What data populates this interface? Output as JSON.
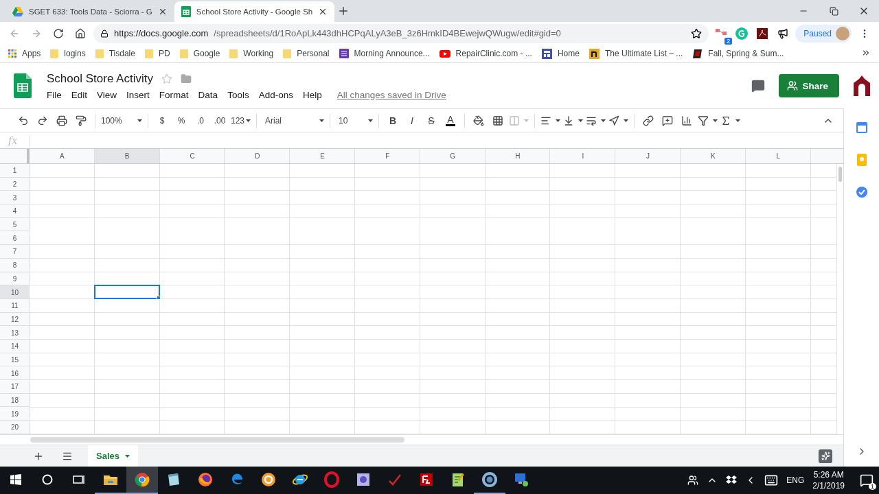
{
  "browser": {
    "tabs": [
      {
        "title": "SGET 633: Tools Data - Sciorra - G",
        "kind": "drive",
        "selected": false
      },
      {
        "title": "School Store Activity - Google Sh",
        "kind": "sheets",
        "selected": true
      }
    ],
    "url_host": "https://docs.google.com",
    "url_path": "/spreadsheets/d/1RoApLk443dhHCPqALyA3eB_3z6HmkID4BEwejwQWugw/edit#gid=0",
    "extension_badge": "2",
    "profile": "Paused",
    "bookmarks": [
      {
        "label": "Apps",
        "kind": "apps"
      },
      {
        "label": "logins",
        "kind": "folder"
      },
      {
        "label": "Tisdale",
        "kind": "folder"
      },
      {
        "label": "PD",
        "kind": "folder"
      },
      {
        "label": "Google",
        "kind": "folder"
      },
      {
        "label": "Working",
        "kind": "folder"
      },
      {
        "label": "Personal",
        "kind": "folder"
      },
      {
        "label": "Morning Announce...",
        "kind": "form"
      },
      {
        "label": "RepairClinic.com - ...",
        "kind": "video"
      },
      {
        "label": "Home",
        "kind": "site"
      },
      {
        "label": "The Ultimate List – ...",
        "kind": "n"
      },
      {
        "label": "Fall, Spring & Sum...",
        "kind": "bc"
      }
    ]
  },
  "doc": {
    "title": "School Store Activity",
    "menu": [
      "File",
      "Edit",
      "View",
      "Insert",
      "Format",
      "Data",
      "Tools",
      "Add-ons",
      "Help"
    ],
    "save_status": "All changes saved in Drive",
    "share": "Share"
  },
  "toolbar": {
    "zoom": "100%",
    "currency": "$",
    "percent": "%",
    "decrease_decimal": ".0",
    "increase_decimal": ".00",
    "more_formats": "123",
    "font": "Arial",
    "font_size": "10",
    "bold": "B",
    "italic": "I",
    "strikethrough": "S",
    "text_color": "A"
  },
  "formula_bar": {
    "label": "fx"
  },
  "grid": {
    "columns": [
      {
        "label": "A",
        "selected": false
      },
      {
        "label": "B",
        "selected": true
      },
      {
        "label": "C",
        "selected": false
      },
      {
        "label": "D",
        "selected": false
      },
      {
        "label": "E",
        "selected": false
      },
      {
        "label": "F",
        "selected": false
      },
      {
        "label": "G",
        "selected": false
      },
      {
        "label": "H",
        "selected": false
      },
      {
        "label": "I",
        "selected": false
      },
      {
        "label": "J",
        "selected": false
      },
      {
        "label": "K",
        "selected": false
      },
      {
        "label": "L",
        "selected": false
      }
    ],
    "rows": [
      {
        "label": "1",
        "selected": false
      },
      {
        "label": "2",
        "selected": false
      },
      {
        "label": "3",
        "selected": false
      },
      {
        "label": "4",
        "selected": false
      },
      {
        "label": "5",
        "selected": false
      },
      {
        "label": "6",
        "selected": false
      },
      {
        "label": "7",
        "selected": false
      },
      {
        "label": "8",
        "selected": false
      },
      {
        "label": "9",
        "selected": false
      },
      {
        "label": "10",
        "selected": true
      },
      {
        "label": "11",
        "selected": false
      },
      {
        "label": "12",
        "selected": false
      },
      {
        "label": "13",
        "selected": false
      },
      {
        "label": "14",
        "selected": false
      },
      {
        "label": "15",
        "selected": false
      },
      {
        "label": "16",
        "selected": false
      },
      {
        "label": "17",
        "selected": false
      },
      {
        "label": "18",
        "selected": false
      },
      {
        "label": "19",
        "selected": false
      },
      {
        "label": "20",
        "selected": false
      }
    ]
  },
  "sheets": [
    {
      "label": "Sales",
      "selected": true
    }
  ],
  "taskbar": {
    "apps": [
      {
        "kind": "explorer",
        "running": true,
        "selected": false
      },
      {
        "kind": "chrome",
        "running": true,
        "selected": true
      },
      {
        "kind": "notepad",
        "running": false,
        "selected": false
      },
      {
        "kind": "firefox",
        "running": false,
        "selected": false
      },
      {
        "kind": "edge",
        "running": false,
        "selected": false
      },
      {
        "kind": "gear",
        "running": false,
        "selected": false
      },
      {
        "kind": "ie",
        "running": false,
        "selected": false
      },
      {
        "kind": "opera",
        "running": false,
        "selected": false
      },
      {
        "kind": "studio",
        "running": false,
        "selected": false
      },
      {
        "kind": "check",
        "running": false,
        "selected": false
      },
      {
        "kind": "filezilla",
        "running": false,
        "selected": false
      },
      {
        "kind": "editor",
        "running": false,
        "selected": false
      },
      {
        "kind": "ring",
        "running": true,
        "selected": false
      },
      {
        "kind": "remote",
        "running": false,
        "selected": false
      }
    ],
    "language": "ENG",
    "time": "5:26 AM",
    "date": "2/1/2019",
    "notifications": "1"
  }
}
